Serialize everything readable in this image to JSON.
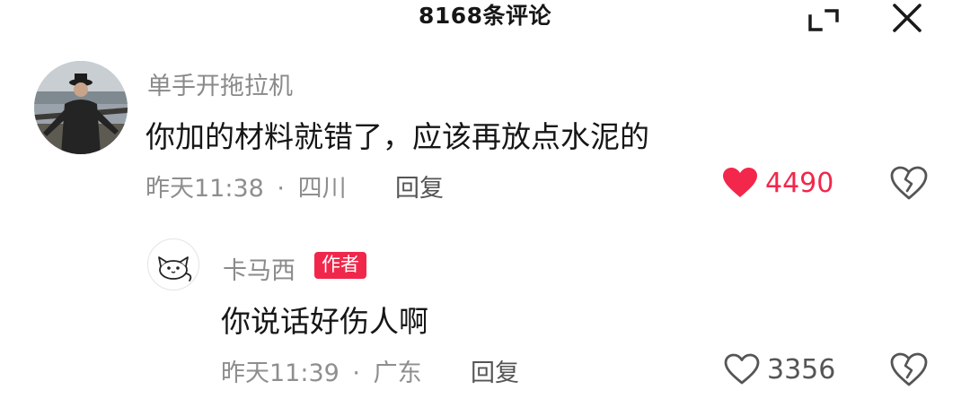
{
  "header": {
    "title": "8168条评论"
  },
  "comments": [
    {
      "username": "单手开拖拉机",
      "text": "你加的材料就错了，应该再放点水泥的",
      "time": "昨天11:38",
      "separator": "·",
      "location": "四川",
      "reply_label": "回复",
      "likes": "4490",
      "liked": true,
      "like_color": "#f2274b"
    },
    {
      "username": "卡马西",
      "badge": "作者",
      "text": "你说话好伤人啊",
      "time": "昨天11:39",
      "separator": "·",
      "location": "广东",
      "reply_label": "回复",
      "likes": "3356",
      "liked": false,
      "like_color": "#555555"
    }
  ],
  "icons": {
    "expand": "expand-icon",
    "close": "close-icon",
    "heart": "heart-icon",
    "dislike": "broken-heart-icon",
    "avatar_cat": "cat-avatar-icon"
  }
}
